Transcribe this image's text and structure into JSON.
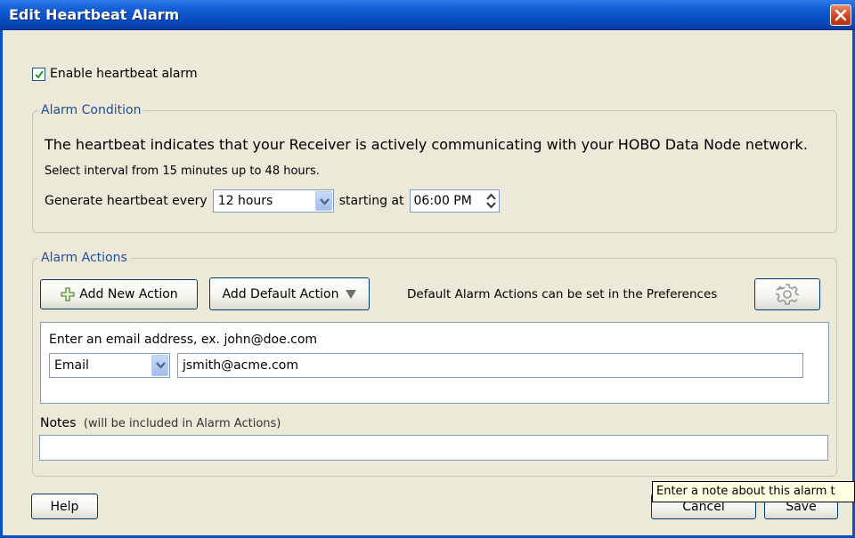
{
  "window": {
    "title": "Edit Heartbeat Alarm",
    "close_icon": "close-icon"
  },
  "enable": {
    "label": "Enable heartbeat alarm",
    "checked": true
  },
  "condition": {
    "legend": "Alarm Condition",
    "description": "The heartbeat indicates that your Receiver is actively communicating with your HOBO Data Node network.",
    "interval_hint": "Select interval from 15 minutes up to 48 hours.",
    "generate_label": "Generate heartbeat every",
    "interval_value": "12 hours",
    "starting_label": "starting at",
    "start_time": "06:00 PM"
  },
  "actions": {
    "legend": "Alarm Actions",
    "add_new_label": "Add New Action",
    "add_default_label": "Add Default Action",
    "prefs_text": "Default Alarm Actions can be set in the Preferences",
    "prefs_icon": "gear-icon",
    "email_prompt": "Enter an email address, ex. john@doe.com",
    "method_value": "Email",
    "email_value": "jsmith@acme.com",
    "notes_label": "Notes",
    "notes_hint": "(will be included in Alarm Actions)",
    "notes_value": ""
  },
  "footer": {
    "help_label": "Help",
    "cancel_label": "Cancel",
    "save_label": "Save",
    "tooltip": "Enter a note about this alarm t"
  },
  "colors": {
    "titlebar": "#0A4FC6",
    "background": "#ECE9D8",
    "legend_text": "#1F4E9E",
    "button_border": "#003C74"
  }
}
